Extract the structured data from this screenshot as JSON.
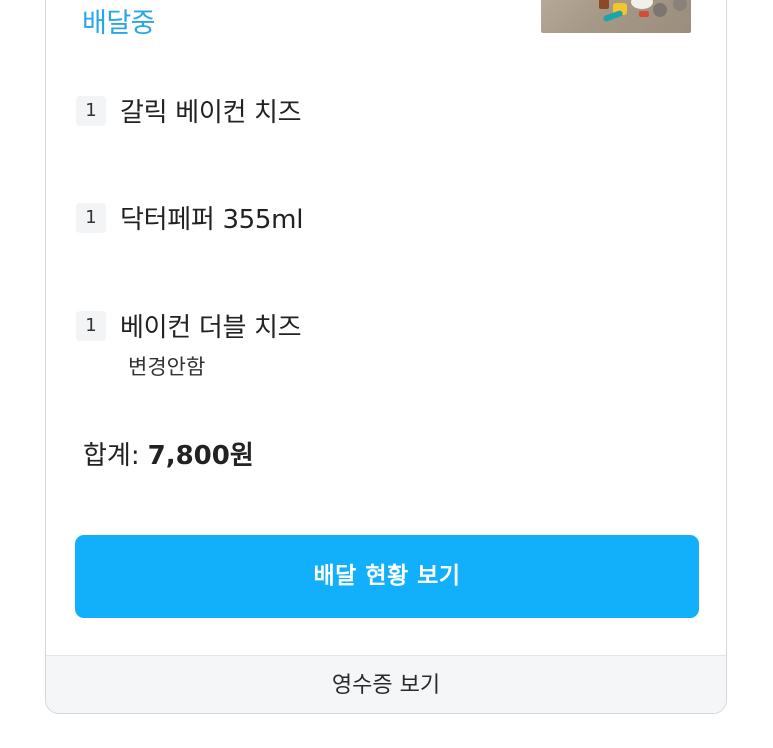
{
  "order": {
    "status": "배달중",
    "items": [
      {
        "qty": "1",
        "name": "갈릭 베이컨 치즈",
        "option": ""
      },
      {
        "qty": "1",
        "name": "닥터페퍼 355ml",
        "option": ""
      },
      {
        "qty": "1",
        "name": "베이컨 더블 치즈",
        "option": "변경안함"
      }
    ],
    "total_label": "합계:",
    "total_amount": "7,800원"
  },
  "actions": {
    "track_label": "배달 현황 보기",
    "receipt_label": "영수증 보기"
  },
  "colors": {
    "accent": "#12b0fb",
    "status": "#2aa6e8"
  }
}
